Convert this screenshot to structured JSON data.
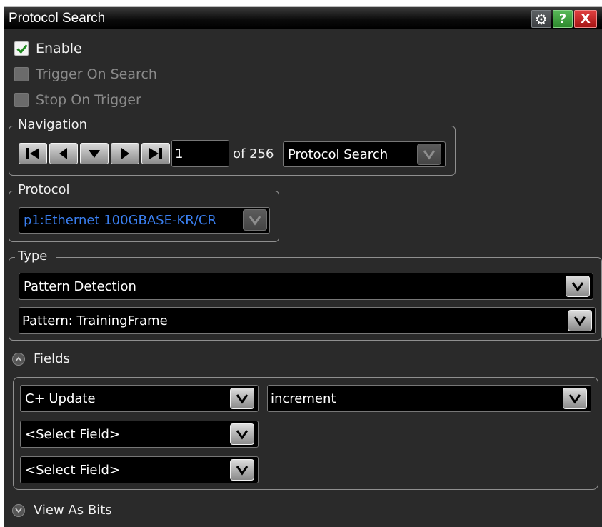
{
  "window": {
    "title": "Protocol Search",
    "icons": [
      "gear-icon",
      "help-icon",
      "close-icon"
    ],
    "help_label": "?",
    "close_label": "X"
  },
  "options": {
    "enable": {
      "label": "Enable",
      "checked": true
    },
    "trigger_on_search": {
      "label": "Trigger On Search",
      "checked": false,
      "enabled": false
    },
    "stop_on_trigger": {
      "label": "Stop On Trigger",
      "checked": false,
      "enabled": false
    }
  },
  "navigation": {
    "legend": "Navigation",
    "buttons": [
      "first",
      "previous",
      "down",
      "next",
      "last"
    ],
    "index_value": "1",
    "of_text": "of 256",
    "source": "Protocol Search"
  },
  "protocol": {
    "legend": "Protocol",
    "selected": "p1:Ethernet 100GBASE-KR/CR",
    "selected_color": "#3a7ff0"
  },
  "type": {
    "legend": "Type",
    "search_type": "Pattern Detection",
    "pattern": "Pattern: TrainingFrame"
  },
  "fields": {
    "label": "Fields",
    "expanded": true,
    "rows": [
      {
        "field": "C+ Update",
        "value": "increment"
      },
      {
        "field": "<Select Field>"
      },
      {
        "field": "<Select Field>"
      }
    ]
  },
  "view_as_bits": {
    "label": "View As Bits",
    "expanded": false
  }
}
